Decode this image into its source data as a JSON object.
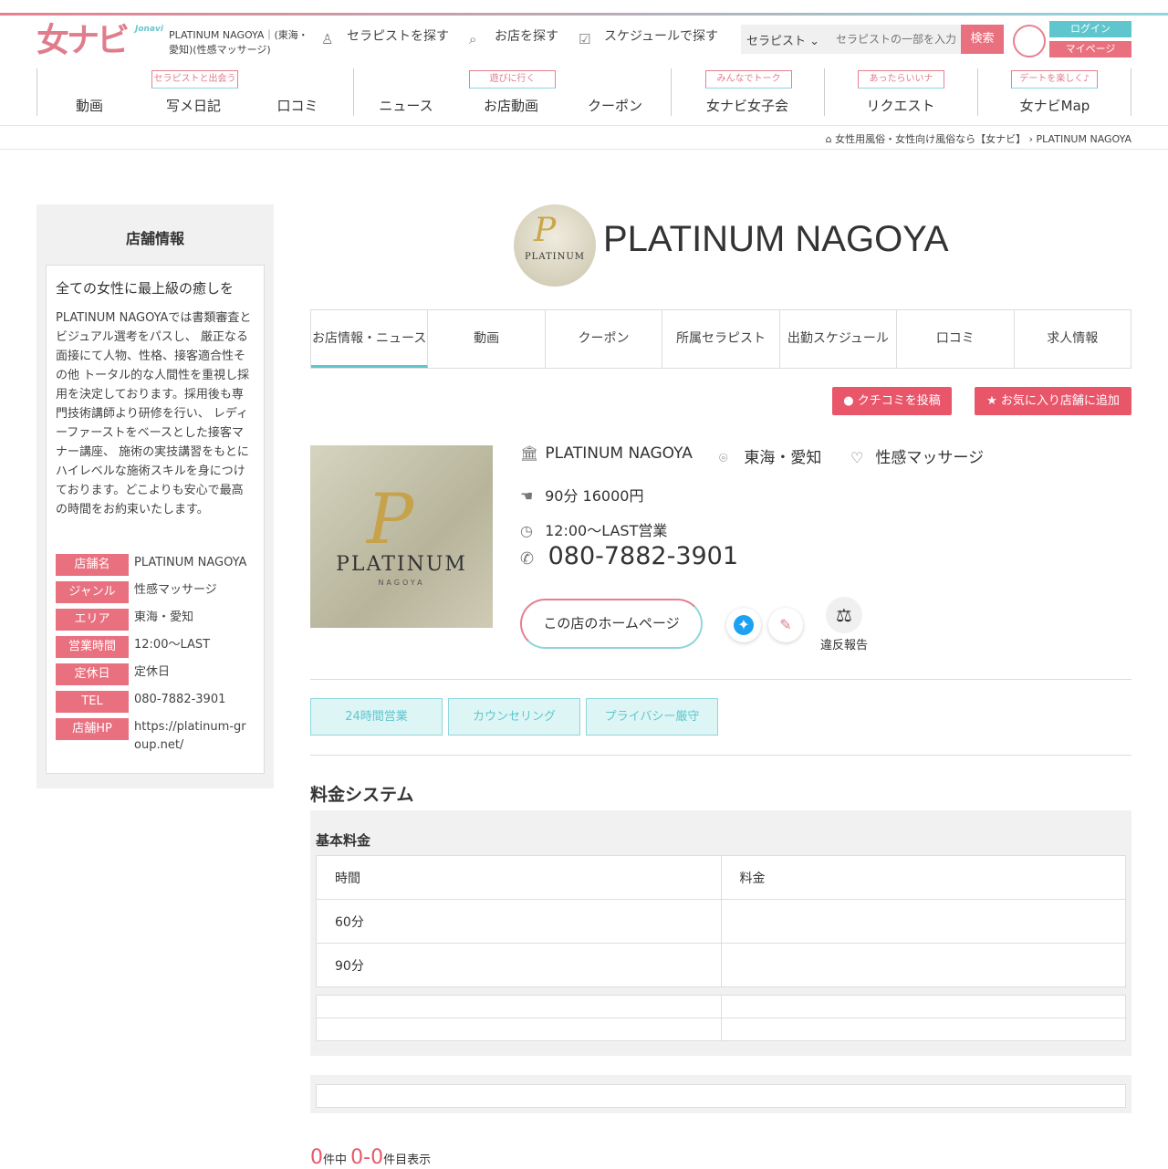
{
  "header": {
    "logo_text": "女ナビ",
    "logo_sub": "Jonavi",
    "shop_caption": "PLATINUM NAGOYA｜(東海・愛知)(性感マッサージ)",
    "links": [
      "セラピストを探す",
      "お店を探す",
      "スケジュールで探す"
    ],
    "search_select": "セラピスト",
    "search_placeholder": "セラピストの一部を入力",
    "search_button": "検索",
    "login": "ログイン",
    "mypage": "マイページ"
  },
  "nav": {
    "items": [
      "動画",
      "写メ日記",
      "口コミ",
      "ニュース",
      "お店動画",
      "クーポン",
      "女ナビ女子会",
      "リクエスト",
      "女ナビMap"
    ],
    "badges": [
      "セラピストと出会う",
      "遊びに行く",
      "みんなでトーク",
      "あったらいいナ",
      "デートを楽しく♪"
    ]
  },
  "breadcrumb": {
    "home": "女性用風俗・女性向け風俗なら【女ナビ】",
    "current": "PLATINUM NAGOYA"
  },
  "sidebar": {
    "title": "店舗情報",
    "catch": "全ての女性に最上級の癒しを",
    "description": "PLATINUM NAGOYAでは書類審査とビジュアル選考をパスし、 厳正なる面接にて人物、性格、接客適合性その他 トータル的な人間性を重視し採用を決定しております。採用後も専門技術講師より研修を行い、 レディーファーストをベースとした接客マナー講座、 施術の実技講習をもとに ハイレベルな施術スキルを身につけております。どこよりも安心で最高の時間をお約束いたします。",
    "info": [
      {
        "label": "店舗名",
        "value": "PLATINUM NAGOYA"
      },
      {
        "label": "ジャンル",
        "value": "性感マッサージ"
      },
      {
        "label": "エリア",
        "value": "東海・愛知"
      },
      {
        "label": "営業時間",
        "value": "12:00〜LAST"
      },
      {
        "label": "定休日",
        "value": "定休日"
      },
      {
        "label": "TEL",
        "value": "080-7882-3901"
      },
      {
        "label": "店舗HP",
        "value": "https://platinum-group.net/"
      }
    ]
  },
  "shop": {
    "name": "PLATINUM NAGOYA",
    "logo_letter": "P",
    "logo_word": "PLATINUM",
    "logo_sub": "NAGOYA",
    "area": "東海・愛知",
    "genre": "性感マッサージ",
    "price": "90分 16000円",
    "hours": "12:00〜LAST営業",
    "tel": "080-7882-3901",
    "hp_button": "この店のホームページ",
    "report": "違反報告"
  },
  "tabs": [
    "お店情報・ニュース",
    "動画",
    "クーポン",
    "所属セラピスト",
    "出勤スケジュール",
    "口コミ",
    "求人情報"
  ],
  "actions": {
    "kuchikomi": "クチコミを投稿",
    "favorite": "お気に入り店舗に追加"
  },
  "tags": [
    "24時間営業",
    "カウンセリング",
    "プライバシー厳守"
  ],
  "pricing": {
    "title": "料金システム",
    "subtitle": "基本料金",
    "headers": [
      "時間",
      "料金"
    ],
    "rows": [
      [
        "60分",
        ""
      ],
      [
        "90分",
        ""
      ]
    ]
  },
  "results": {
    "total": "0",
    "total_suffix": "件中",
    "range": "0-0",
    "range_suffix": "件目表示"
  },
  "colors": {
    "accent_pink": "#e9707f",
    "accent_teal": "#5fc6ce"
  }
}
